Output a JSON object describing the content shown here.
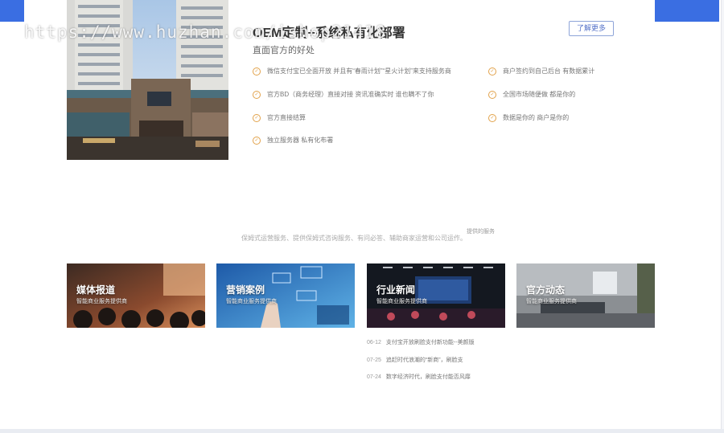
{
  "watermark": "https://www.huzhan.com/ishop21418",
  "oem": {
    "title": "OEM定制+系统私有化部署",
    "subtitle": "直面官方的好处",
    "more_label": "了解更多",
    "features_left": [
      "微信支付宝已全面开放 并且有“春雨计划”“星火计划”来支持服务商",
      "官方BD（商务经理）直接对接 资讯准确实时 谁也瞒不了你",
      "官方直接结算",
      "独立服务器 私有化布署"
    ],
    "features_right": [
      "商户签约到自己后台 有数据累计",
      "全国市场随便做 都是你的",
      "数据是你的 商户是你的"
    ]
  },
  "services": {
    "tag": "提供的服务",
    "text": "保姆式运营服务、提供保姆式咨询服务、有问必答、辅助商家运营和公司运作。"
  },
  "cards": [
    {
      "title": "媒体报道",
      "desc": "智能商业服务提供商"
    },
    {
      "title": "营销案例",
      "desc": "智能商业服务提供商"
    },
    {
      "title": "行业新闻",
      "desc": "智能商业服务提供商"
    },
    {
      "title": "官方动态",
      "desc": "智能商业服务提供商"
    }
  ],
  "news": [
    {
      "date": "06-12",
      "title": "支付宝开放刷脸支付新功能--美颜版"
    },
    {
      "date": "07-25",
      "title": "追赶时代浪潮的“新商”，刷脸支"
    },
    {
      "date": "07-24",
      "title": "数字经济时代，刷脸支付能否风靡"
    }
  ],
  "icons": {
    "check": "check-circle-icon"
  },
  "colors": {
    "accent_blue": "#3a6ee2",
    "check_orange": "#e2a24a",
    "button_border": "#8ea4d8"
  }
}
